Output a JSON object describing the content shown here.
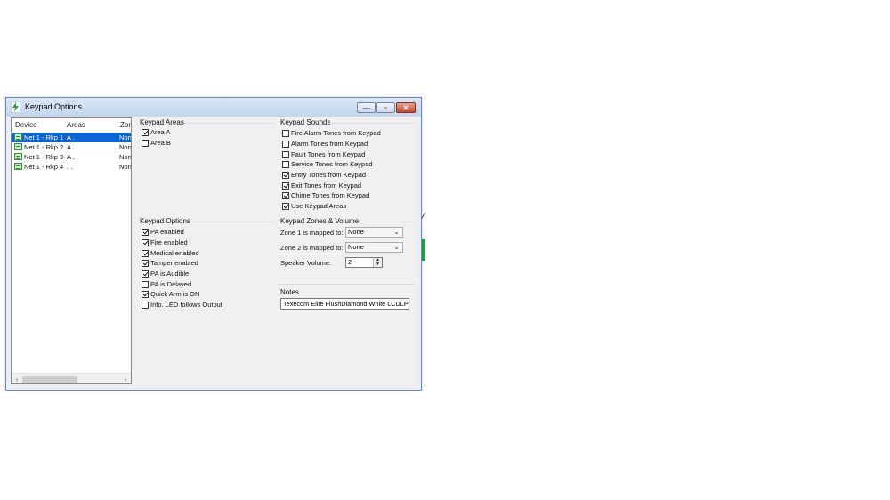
{
  "window": {
    "title": "Keypad Options",
    "buttons": {
      "minimize": "—",
      "maximize": "▫",
      "close": "✕"
    }
  },
  "device_list": {
    "columns": [
      "Device",
      "Areas",
      "Zone"
    ],
    "rows": [
      {
        "device": "Net 1 - Rkp 1",
        "areas": "A .",
        "zone": "None",
        "selected": true
      },
      {
        "device": "Net 1 - Rkp 2",
        "areas": "A .",
        "zone": "None",
        "selected": false
      },
      {
        "device": "Net 1 - Rkp 3",
        "areas": "A .",
        "zone": "None",
        "selected": false
      },
      {
        "device": "Net 1 - Rkp 4",
        "areas": ". .",
        "zone": "None",
        "selected": false
      }
    ],
    "scroll_left": "‹",
    "scroll_right": "›"
  },
  "keypad_areas": {
    "title": "Keypad Areas",
    "items": [
      {
        "label": "Area A",
        "checked": true
      },
      {
        "label": "Area B",
        "checked": false
      }
    ]
  },
  "keypad_sounds": {
    "title": "Keypad Sounds",
    "items": [
      {
        "label": "Fire Alarm Tones from Keypad",
        "checked": false
      },
      {
        "label": "Alarm Tones from Keypad",
        "checked": false
      },
      {
        "label": "Fault Tones from Keypad",
        "checked": false
      },
      {
        "label": "Service Tones from Keypad",
        "checked": false
      },
      {
        "label": "Entry Tones from Keypad",
        "checked": true
      },
      {
        "label": "Exit Tones from Keypad",
        "checked": true
      },
      {
        "label": "Chime Tones from Keypad",
        "checked": true
      },
      {
        "label": "Use Keypad Areas",
        "checked": true
      }
    ]
  },
  "keypad_options": {
    "title": "Keypad Options",
    "items": [
      {
        "label": "PA enabled",
        "checked": true
      },
      {
        "label": "Fire enabled",
        "checked": true
      },
      {
        "label": "Medical enabled",
        "checked": true
      },
      {
        "label": "Tamper enabled",
        "checked": true
      },
      {
        "label": "PA is Audible",
        "checked": true
      },
      {
        "label": "PA is Delayed",
        "checked": false
      },
      {
        "label": "Quick Arm is ON",
        "checked": true
      },
      {
        "label": "Info. LED follows Output",
        "checked": false
      }
    ]
  },
  "zones_volume": {
    "title": "Keypad Zones & Volume",
    "zone1_label": "Zone 1 is mapped to:",
    "zone1_value": "None",
    "zone2_label": "Zone 2 is mapped to:",
    "zone2_value": "None",
    "volume_label": "Speaker Volume:",
    "volume_value": "2"
  },
  "notes": {
    "title": "Notes",
    "value": "Texecom Elite FlushDiamond White LCDLP"
  }
}
